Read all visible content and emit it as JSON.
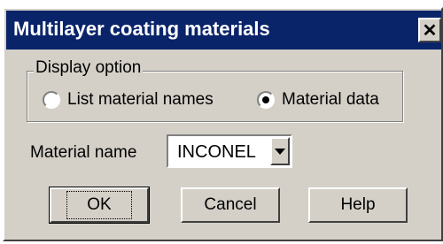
{
  "window": {
    "title": "Multilayer coating materials",
    "close_label": "✕"
  },
  "display_option": {
    "legend": "Display option",
    "options": [
      {
        "label": "List material names",
        "selected": false
      },
      {
        "label": "Material data",
        "selected": true
      }
    ]
  },
  "material": {
    "label": "Material name",
    "value": "INCONEL"
  },
  "buttons": {
    "ok": "OK",
    "cancel": "Cancel",
    "help": "Help"
  }
}
